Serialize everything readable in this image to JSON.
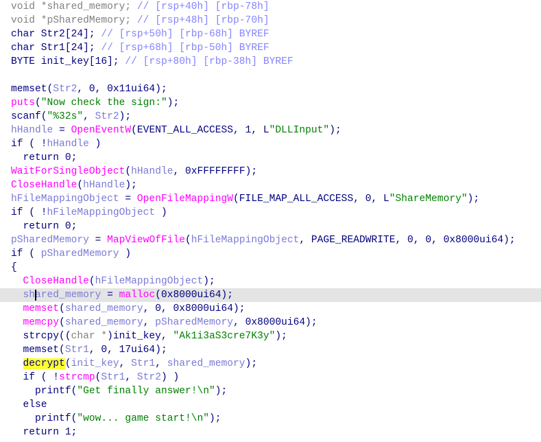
{
  "view": "pseudocode",
  "current_line": 21,
  "lines": [
    [
      [
        "decl",
        "void *shared_memory; "
      ],
      [
        "cmt",
        "// [rsp+40h] [rbp-78h]"
      ]
    ],
    [
      [
        "decl",
        "void *pSharedMemory; "
      ],
      [
        "cmt",
        "// [rsp+48h] [rbp-70h]"
      ]
    ],
    [
      [
        "norm",
        "char Str2[24]; "
      ],
      [
        "cmt",
        "// [rsp+50h] [rbp-68h] BYREF"
      ]
    ],
    [
      [
        "norm",
        "char Str1[24]; "
      ],
      [
        "cmt",
        "// [rsp+68h] [rbp-50h] BYREF"
      ]
    ],
    [
      [
        "norm",
        "BYTE init_key[16]; "
      ],
      [
        "cmt",
        "// [rsp+80h] [rbp-38h] BYREF"
      ]
    ],
    [],
    [
      [
        "norm",
        "memset("
      ],
      [
        "var",
        "Str2"
      ],
      [
        "norm",
        ", 0, 0x11ui64);"
      ]
    ],
    [
      [
        "imp",
        "puts"
      ],
      [
        "norm",
        "("
      ],
      [
        "str",
        "\"Now check the sign:\""
      ],
      [
        "norm",
        ");"
      ]
    ],
    [
      [
        "norm",
        "scanf("
      ],
      [
        "str",
        "\"%32s\""
      ],
      [
        "norm",
        ", "
      ],
      [
        "var",
        "Str2"
      ],
      [
        "norm",
        ");"
      ]
    ],
    [
      [
        "var",
        "hHandle"
      ],
      [
        "norm",
        " = "
      ],
      [
        "imp",
        "OpenEventW"
      ],
      [
        "norm",
        "(EVENT_ALL_ACCESS, 1, L"
      ],
      [
        "str",
        "\"DLLInput\""
      ],
      [
        "norm",
        ");"
      ]
    ],
    [
      [
        "norm",
        "if ( !"
      ],
      [
        "var",
        "hHandle"
      ],
      [
        "norm",
        " )"
      ]
    ],
    [
      [
        "norm",
        "  return 0;"
      ]
    ],
    [
      [
        "imp",
        "WaitForSingleObject"
      ],
      [
        "norm",
        "("
      ],
      [
        "var",
        "hHandle"
      ],
      [
        "norm",
        ", 0xFFFFFFFF);"
      ]
    ],
    [
      [
        "imp",
        "CloseHandle"
      ],
      [
        "norm",
        "("
      ],
      [
        "var",
        "hHandle"
      ],
      [
        "norm",
        ");"
      ]
    ],
    [
      [
        "var",
        "hFileMappingObject"
      ],
      [
        "norm",
        " = "
      ],
      [
        "imp",
        "OpenFileMappingW"
      ],
      [
        "norm",
        "(FILE_MAP_ALL_ACCESS, 0, L"
      ],
      [
        "str",
        "\"ShareMemory\""
      ],
      [
        "norm",
        ");"
      ]
    ],
    [
      [
        "norm",
        "if ( !"
      ],
      [
        "var",
        "hFileMappingObject"
      ],
      [
        "norm",
        " )"
      ]
    ],
    [
      [
        "norm",
        "  return 0;"
      ]
    ],
    [
      [
        "var",
        "pSharedMemory"
      ],
      [
        "norm",
        " = "
      ],
      [
        "imp",
        "MapViewOfFile"
      ],
      [
        "norm",
        "("
      ],
      [
        "var",
        "hFileMappingObject"
      ],
      [
        "norm",
        ", PAGE_READWRITE, 0, 0, 0x8000ui64);"
      ]
    ],
    [
      [
        "norm",
        "if ( "
      ],
      [
        "var",
        "pSharedMemory"
      ],
      [
        "norm",
        " )"
      ]
    ],
    [
      [
        "norm",
        "{"
      ]
    ],
    [
      [
        "norm",
        "  "
      ],
      [
        "imp",
        "CloseHandle"
      ],
      [
        "norm",
        "("
      ],
      [
        "var",
        "hFileMappingObject"
      ],
      [
        "norm",
        ");"
      ]
    ],
    [
      [
        "norm",
        "  "
      ],
      [
        "var",
        "shared_memory"
      ],
      [
        "norm",
        " = "
      ],
      [
        "imp",
        "malloc"
      ],
      [
        "norm",
        "(0x8000ui64);"
      ]
    ],
    [
      [
        "norm",
        "  "
      ],
      [
        "imp",
        "memset"
      ],
      [
        "norm",
        "("
      ],
      [
        "var",
        "shared_memory"
      ],
      [
        "norm",
        ", 0, 0x8000ui64);"
      ]
    ],
    [
      [
        "norm",
        "  "
      ],
      [
        "imp",
        "memcpy"
      ],
      [
        "norm",
        "("
      ],
      [
        "var",
        "shared_memory"
      ],
      [
        "norm",
        ", "
      ],
      [
        "var",
        "pSharedMemory"
      ],
      [
        "norm",
        ", 0x8000ui64);"
      ]
    ],
    [
      [
        "norm",
        "  strcpy(("
      ],
      [
        "cast",
        "char *"
      ],
      [
        "norm",
        ")init_key, "
      ],
      [
        "str",
        "\"Ak1i3aS3cre7K3y\""
      ],
      [
        "norm",
        ");"
      ]
    ],
    [
      [
        "norm",
        "  memset("
      ],
      [
        "var",
        "Str1"
      ],
      [
        "norm",
        ", 0, 17ui64);"
      ]
    ],
    [
      [
        "norm",
        "  "
      ],
      [
        "hl",
        "decrypt"
      ],
      [
        "norm",
        "("
      ],
      [
        "var",
        "init_key"
      ],
      [
        "norm",
        ", "
      ],
      [
        "var",
        "Str1"
      ],
      [
        "norm",
        ", "
      ],
      [
        "var",
        "shared_memory"
      ],
      [
        "norm",
        ");"
      ]
    ],
    [
      [
        "norm",
        "  if ( !"
      ],
      [
        "imp",
        "strcmp"
      ],
      [
        "norm",
        "("
      ],
      [
        "var",
        "Str1"
      ],
      [
        "norm",
        ", "
      ],
      [
        "var",
        "Str2"
      ],
      [
        "norm",
        ") )"
      ]
    ],
    [
      [
        "norm",
        "    printf("
      ],
      [
        "str",
        "\"Get finally answer!\\n\""
      ],
      [
        "norm",
        ");"
      ]
    ],
    [
      [
        "norm",
        "  else"
      ]
    ],
    [
      [
        "norm",
        "    printf("
      ],
      [
        "str",
        "\"wow... game start!\\n\""
      ],
      [
        "norm",
        ");"
      ]
    ],
    [
      [
        "norm",
        "  return 1;"
      ]
    ]
  ]
}
